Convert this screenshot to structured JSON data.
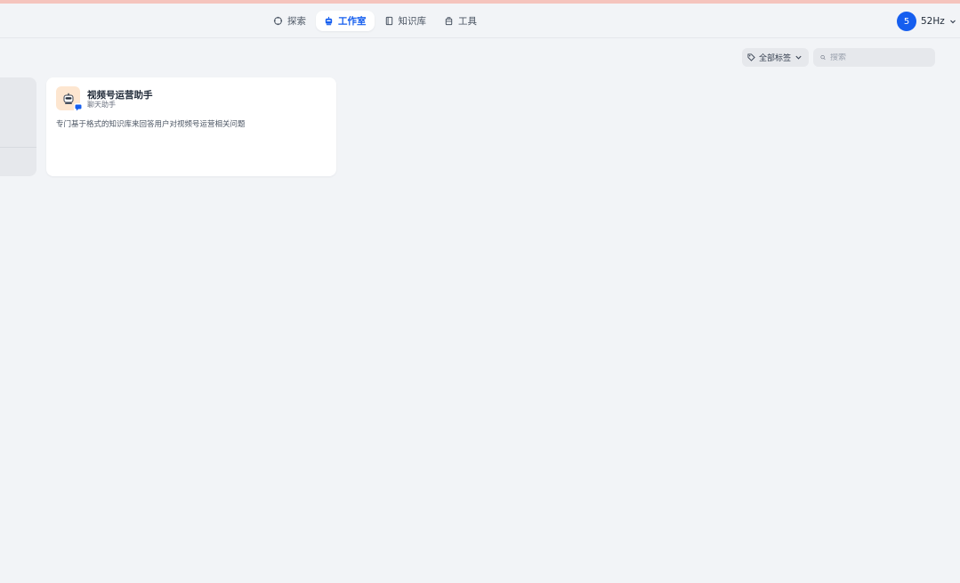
{
  "header": {
    "nav": [
      {
        "label": "探索",
        "icon": "compass-icon",
        "active": false
      },
      {
        "label": "工作室",
        "icon": "robot-icon",
        "active": true
      },
      {
        "label": "知识库",
        "icon": "book-icon",
        "active": false
      },
      {
        "label": "工具",
        "icon": "briefcase-icon",
        "active": false
      }
    ],
    "user": {
      "initial": "5",
      "name": "52Hz"
    }
  },
  "toolbar": {
    "tag_filter_label": "全部标签",
    "search_placeholder": "搜索"
  },
  "apps": [
    {
      "title": "视频号运营助手",
      "subtitle": "聊天助手",
      "description": "专门基于格式的知识库来回答用户对视频号运营相关问题",
      "icon": "robot-icon"
    }
  ],
  "colors": {
    "accent": "#155eef",
    "top_bar": "#f5c4bd",
    "background": "#f2f4f7",
    "app_icon_bg": "#fde6d0"
  }
}
